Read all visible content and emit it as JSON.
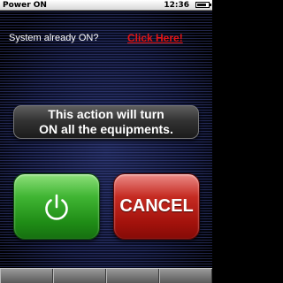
{
  "status_bar": {
    "title": "Power ON",
    "time": "12:36",
    "battery_level": 0.85
  },
  "prompt": {
    "text": "System already ON?",
    "link_label": "Click Here!"
  },
  "message": {
    "line1": "This action will turn",
    "line2": "ON all the equipments."
  },
  "buttons": {
    "power_icon": "power-icon",
    "cancel_label": "CANCEL"
  },
  "colors": {
    "link": "#e41414",
    "power_button": "#2fa325",
    "cancel_button": "#b81a12"
  },
  "softkeys_count": 4
}
